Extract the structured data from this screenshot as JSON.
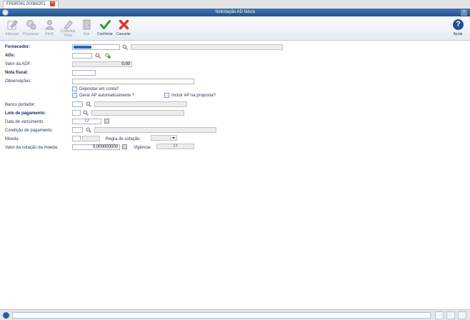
{
  "tab": {
    "label": "FIN30041.00066201"
  },
  "window": {
    "title": "Solicitação AD fatura"
  },
  "toolbar": {
    "informar": "Informar",
    "processar": "Processar",
    "perfil": "Perfil",
    "consultar_1": "Consultar",
    "consultar_2": "Título",
    "sair": "Sair",
    "confirmar": "Confirmar",
    "cancelar": "Cancelar",
    "ajuda": "Ajuda"
  },
  "form": {
    "fornecedor": {
      "label": "Fornecedor:"
    },
    "ads": {
      "label": "ADs:"
    },
    "valor_adf": {
      "label": "Valor da ADF:",
      "value": "0,00"
    },
    "nota_fiscal": {
      "label": "Nota fiscal:"
    },
    "observacoes": {
      "label": "Observações:"
    },
    "depositar": {
      "label": "Depositar em conta?"
    },
    "gerar_ap": {
      "label": "Gerar AP automaticamente ?"
    },
    "incluir_ap": {
      "label": "Incluir AP na proposta?"
    },
    "banco_portador": {
      "label": "Banco portador:"
    },
    "lote_pagamento": {
      "label": "Lote de pagamento:"
    },
    "data_vencimento": {
      "label": "Data de vencimento:",
      "value": "/ /"
    },
    "condicao_pagamento": {
      "label": "Condição de pagamento:"
    },
    "moeda": {
      "label": "Moeda:"
    },
    "regra_cotacao": {
      "label": "Regra de cotação:"
    },
    "valor_cotacao_moeda": {
      "label": "Valor da cotação da moeda:",
      "value": "0,000000000"
    },
    "vigencia": {
      "label": "Vigência:",
      "value": "/ /"
    }
  },
  "colors": {
    "titlebar": "#2f63a0",
    "label_bold": "#0f2d63",
    "selected_field": "#2f63b8",
    "confirm": "#2e9c2e",
    "cancel": "#d33a2c"
  }
}
